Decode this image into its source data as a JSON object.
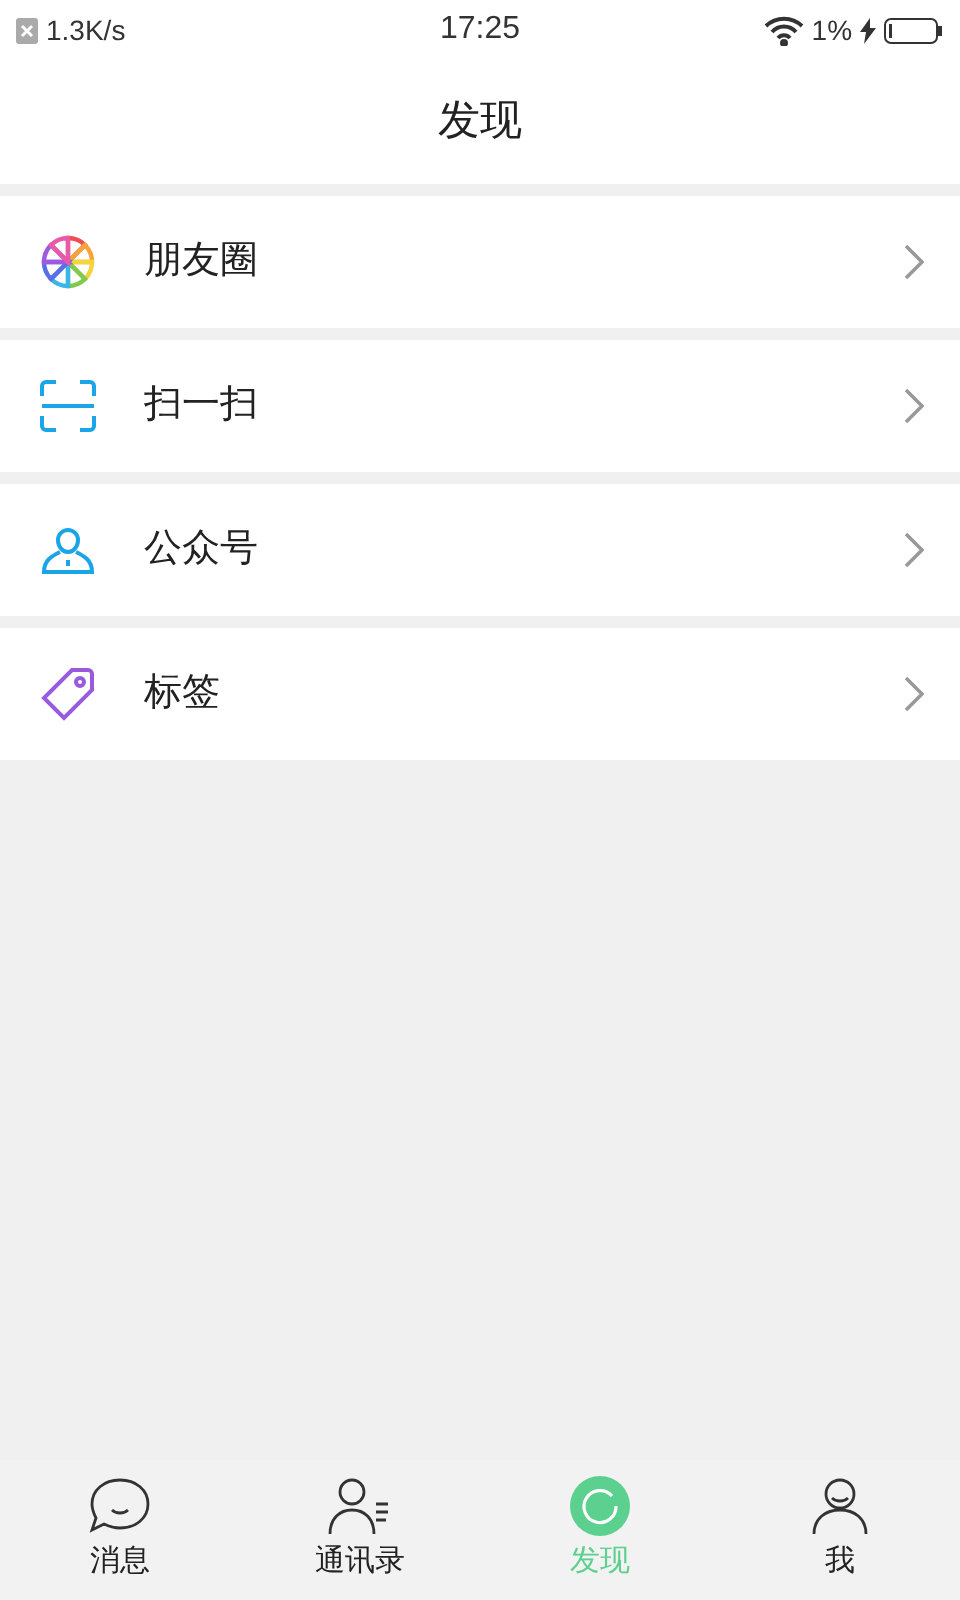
{
  "status_bar": {
    "speed": "1.3K/s",
    "time": "17:25",
    "battery": "1%"
  },
  "header": {
    "title": "发现"
  },
  "menu": [
    {
      "kind": "moments",
      "label": "朋友圈"
    },
    {
      "kind": "scan",
      "label": "扫一扫"
    },
    {
      "kind": "official",
      "label": "公众号"
    },
    {
      "kind": "tag",
      "label": "标签"
    }
  ],
  "tabs": [
    {
      "kind": "chat",
      "label": "消息",
      "selected": false
    },
    {
      "kind": "contacts",
      "label": "通讯录",
      "selected": false
    },
    {
      "kind": "discover",
      "label": "发现",
      "selected": true
    },
    {
      "kind": "me",
      "label": "我",
      "selected": false
    }
  ]
}
